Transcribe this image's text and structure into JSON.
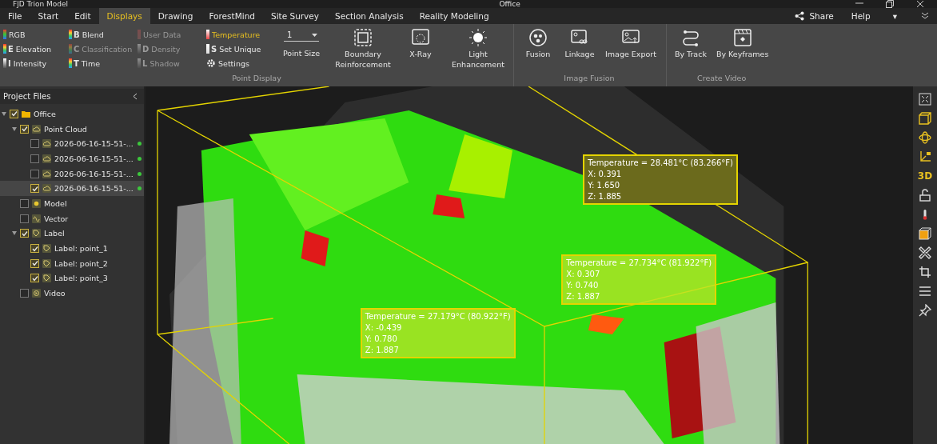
{
  "window": {
    "app_title": "FJD Trion Model",
    "document_title": "Office"
  },
  "menu": [
    {
      "label": "File",
      "selected": false
    },
    {
      "label": "Start",
      "selected": false
    },
    {
      "label": "Edit",
      "selected": false
    },
    {
      "label": "Displays",
      "selected": true
    },
    {
      "label": "Drawing",
      "selected": false
    },
    {
      "label": "ForestMind",
      "selected": false
    },
    {
      "label": "Site Survey",
      "selected": false
    },
    {
      "label": "Section Analysis",
      "selected": false
    },
    {
      "label": "Reality Modeling",
      "selected": false
    }
  ],
  "menu_right": {
    "share": "Share",
    "help": "Help",
    "help_caret": "▾"
  },
  "ribbon": {
    "color_modes": [
      {
        "label": "RGB",
        "kind": "rgb",
        "disabled": false,
        "selected": false
      },
      {
        "label": "Elevation",
        "letter": "E",
        "kind": "rainbow",
        "disabled": false,
        "selected": false
      },
      {
        "label": "Intensity",
        "letter": "I",
        "kind": "gray",
        "disabled": false,
        "selected": false
      },
      {
        "label": "Blend",
        "letter": "B",
        "kind": "rainbow",
        "disabled": false,
        "selected": false
      },
      {
        "label": "Classification",
        "letter": "C",
        "kind": "rainbow",
        "disabled": true,
        "selected": false
      },
      {
        "label": "Time",
        "letter": "T",
        "kind": "rainbow",
        "disabled": false,
        "selected": false
      },
      {
        "label": "User Data",
        "kind": "warm",
        "disabled": true,
        "selected": false
      },
      {
        "label": "Density",
        "letter": "D",
        "kind": "gray",
        "disabled": true,
        "selected": false
      },
      {
        "label": "Shadow",
        "letter": "L",
        "kind": "gray",
        "disabled": true,
        "selected": false
      },
      {
        "label": "Temperature",
        "kind": "thermo",
        "disabled": false,
        "selected": true
      },
      {
        "label": "Set Unique",
        "letter": "S",
        "kind": "white",
        "disabled": false,
        "selected": false
      },
      {
        "label": "Settings",
        "kind": "gear",
        "disabled": false,
        "selected": false
      }
    ],
    "point_size": {
      "value": "1",
      "label": "Point Size"
    },
    "groups": [
      {
        "label": "Point Display",
        "buttons": [
          {
            "kind": "boundary",
            "label": "Boundary Reinforcement"
          },
          {
            "kind": "xray",
            "label": "X-Ray"
          },
          {
            "kind": "light",
            "label": "Light Enhancement"
          }
        ]
      },
      {
        "label": "Image Fusion",
        "buttons": [
          {
            "kind": "fusion",
            "label": "Fusion"
          },
          {
            "kind": "linkage",
            "label": "Linkage"
          },
          {
            "kind": "export",
            "label": "Image Export"
          }
        ]
      },
      {
        "label": "Create Video",
        "buttons": [
          {
            "kind": "track",
            "label": "By Track"
          },
          {
            "kind": "keyframes",
            "label": "By Keyframes"
          }
        ]
      }
    ]
  },
  "sidebar": {
    "title": "Project Files",
    "tree": [
      {
        "label": "Office",
        "kind": "folder",
        "checked": true,
        "expanded": true,
        "selected": false,
        "children": [
          {
            "label": "Point Cloud",
            "kind": "cloud",
            "checked": true,
            "expanded": true,
            "selected": false,
            "children": [
              {
                "label": "2026-06-16-15-51-...",
                "kind": "cloud",
                "checked": false,
                "selected": false,
                "color": "#3cc83c"
              },
              {
                "label": "2026-06-16-15-51-...",
                "kind": "cloud",
                "checked": false,
                "selected": false,
                "color": "#3cc83c"
              },
              {
                "label": "2026-06-16-15-51-...",
                "kind": "cloud",
                "checked": false,
                "selected": false,
                "color": "#3cc83c"
              },
              {
                "label": "2026-06-16-15-51-...",
                "kind": "cloud",
                "checked": true,
                "selected": true,
                "color": "#3cc83c"
              }
            ]
          },
          {
            "label": "Model",
            "kind": "model",
            "checked": false,
            "selected": false
          },
          {
            "label": "Vector",
            "kind": "vector",
            "checked": false,
            "selected": false
          },
          {
            "label": "Label",
            "kind": "tag",
            "checked": true,
            "expanded": true,
            "selected": false,
            "children": [
              {
                "label": "Label: point_1",
                "kind": "tag",
                "checked": true,
                "selected": false
              },
              {
                "label": "Label: point_2",
                "kind": "tag",
                "checked": true,
                "selected": false
              },
              {
                "label": "Label: point_3",
                "kind": "tag",
                "checked": true,
                "selected": false
              }
            ]
          },
          {
            "label": "Video",
            "kind": "video",
            "checked": false,
            "selected": false
          }
        ]
      }
    ]
  },
  "viewport": {
    "labels": [
      {
        "title": "Temperature = 28.481°C (83.266°F)",
        "x": "X: 0.391",
        "y": "Y: 1.650",
        "z": "Z: 1.885",
        "selected": true
      },
      {
        "title": "Temperature = 27.734°C  (81.922°F)",
        "x": "X: 0.307",
        "y": "Y: 0.740",
        "z": "Z: 1.887",
        "selected": false
      },
      {
        "title": "Temperature = 27.179°C  (80.922°F)",
        "x": "X: -0.439",
        "y": "Y: 0.780",
        "z": "Z: 1.887",
        "selected": false
      }
    ]
  },
  "right_toolbar": [
    {
      "kind": "fit",
      "on": false
    },
    {
      "kind": "cube",
      "on": true
    },
    {
      "kind": "orbit",
      "on": true
    },
    {
      "kind": "axes",
      "on": true
    },
    {
      "kind": "text",
      "text": "3D",
      "on": true
    },
    {
      "kind": "lock",
      "on": false
    },
    {
      "kind": "thermo"
    },
    {
      "kind": "box",
      "on": true
    },
    {
      "kind": "cross",
      "on": false
    },
    {
      "kind": "crop",
      "on": false
    },
    {
      "kind": "list",
      "on": false
    },
    {
      "kind": "pin",
      "on": false
    }
  ]
}
